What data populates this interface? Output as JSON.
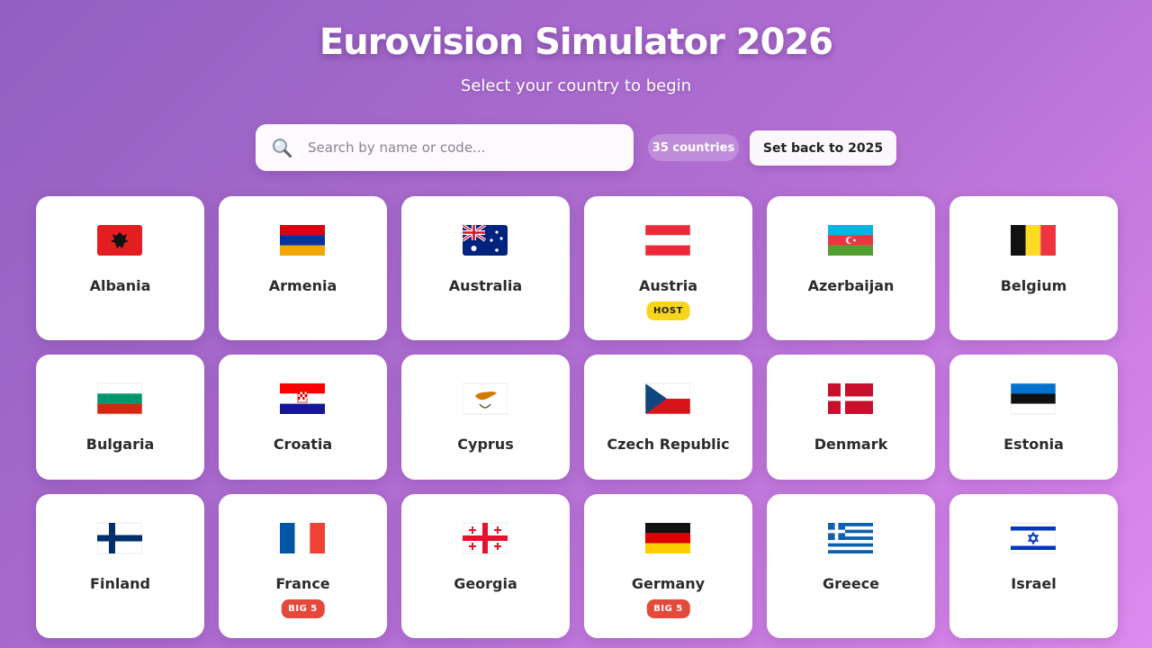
{
  "header": {
    "title": "Eurovision Simulator 2026",
    "subtitle": "Select your country to begin"
  },
  "search": {
    "placeholder": "Search by name or code...",
    "value": "",
    "icon": "search-icon"
  },
  "toolbar": {
    "count_label": "35 countries",
    "reset_label": "Set back to 2025"
  },
  "colors": {
    "host_badge": "#f7d51d",
    "big5_badge": "#e44a3b",
    "background_start": "#9160c0",
    "background_end": "#df8aee"
  },
  "countries": [
    {
      "name": "Albania",
      "badge": ""
    },
    {
      "name": "Armenia",
      "badge": ""
    },
    {
      "name": "Australia",
      "badge": ""
    },
    {
      "name": "Austria",
      "badge": "HOST"
    },
    {
      "name": "Azerbaijan",
      "badge": ""
    },
    {
      "name": "Belgium",
      "badge": ""
    },
    {
      "name": "Bulgaria",
      "badge": ""
    },
    {
      "name": "Croatia",
      "badge": ""
    },
    {
      "name": "Cyprus",
      "badge": ""
    },
    {
      "name": "Czech Republic",
      "badge": ""
    },
    {
      "name": "Denmark",
      "badge": ""
    },
    {
      "name": "Estonia",
      "badge": ""
    },
    {
      "name": "Finland",
      "badge": ""
    },
    {
      "name": "France",
      "badge": "BIG 5"
    },
    {
      "name": "Georgia",
      "badge": ""
    },
    {
      "name": "Germany",
      "badge": "BIG 5"
    },
    {
      "name": "Greece",
      "badge": ""
    },
    {
      "name": "Israel",
      "badge": ""
    }
  ]
}
